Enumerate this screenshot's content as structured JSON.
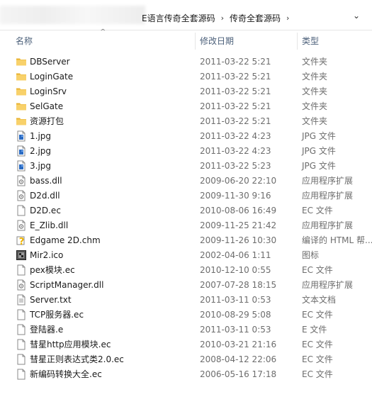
{
  "breadcrumb": {
    "parent": "E语言传奇全套源码",
    "current": "传奇全套源码"
  },
  "columns": {
    "name": "名称",
    "date": "修改日期",
    "type": "类型"
  },
  "files": [
    {
      "name": "DBServer",
      "date": "2011-03-22 5:21",
      "type": "文件夹",
      "icon": "folder-icon"
    },
    {
      "name": "LoginGate",
      "date": "2011-03-22 5:21",
      "type": "文件夹",
      "icon": "folder-icon"
    },
    {
      "name": "LoginSrv",
      "date": "2011-03-22 5:21",
      "type": "文件夹",
      "icon": "folder-icon"
    },
    {
      "name": "SelGate",
      "date": "2011-03-22 5:21",
      "type": "文件夹",
      "icon": "folder-icon"
    },
    {
      "name": "资源打包",
      "date": "2011-03-22 5:21",
      "type": "文件夹",
      "icon": "folder-icon"
    },
    {
      "name": "1.jpg",
      "date": "2011-03-22 4:23",
      "type": "JPG 文件",
      "icon": "image-file-icon"
    },
    {
      "name": "2.jpg",
      "date": "2011-03-22 4:23",
      "type": "JPG 文件",
      "icon": "image-file-icon"
    },
    {
      "name": "3.jpg",
      "date": "2011-03-22 5:23",
      "type": "JPG 文件",
      "icon": "image-file-icon"
    },
    {
      "name": "bass.dll",
      "date": "2009-06-20 22:10",
      "type": "应用程序扩展",
      "icon": "dll-file-icon"
    },
    {
      "name": "D2d.dll",
      "date": "2009-11-30 9:16",
      "type": "应用程序扩展",
      "icon": "dll-file-icon"
    },
    {
      "name": "D2D.ec",
      "date": "2010-08-06 16:49",
      "type": "EC 文件",
      "icon": "blank-file-icon"
    },
    {
      "name": "E_Zlib.dll",
      "date": "2009-11-25 21:42",
      "type": "应用程序扩展",
      "icon": "dll-file-icon"
    },
    {
      "name": "Edgame 2D.chm",
      "date": "2009-11-26 10:30",
      "type": "编译的 HTML 帮...",
      "icon": "help-file-icon"
    },
    {
      "name": "Mir2.ico",
      "date": "2002-04-06 1:11",
      "type": "图标",
      "icon": "ico-file-icon"
    },
    {
      "name": "pex模块.ec",
      "date": "2010-12-10 0:55",
      "type": "EC 文件",
      "icon": "blank-file-icon"
    },
    {
      "name": "ScriptManager.dll",
      "date": "2007-07-28 18:15",
      "type": "应用程序扩展",
      "icon": "dll-file-icon"
    },
    {
      "name": "Server.txt",
      "date": "2011-03-11 0:53",
      "type": "文本文档",
      "icon": "text-file-icon"
    },
    {
      "name": "TCP服务器.ec",
      "date": "2010-08-29 5:08",
      "type": "EC 文件",
      "icon": "blank-file-icon"
    },
    {
      "name": "登陆器.e",
      "date": "2011-03-11 0:53",
      "type": "E 文件",
      "icon": "blank-file-icon"
    },
    {
      "name": "彗星http应用模块.ec",
      "date": "2010-03-21 21:16",
      "type": "EC 文件",
      "icon": "blank-file-icon"
    },
    {
      "name": "彗星正则表达式类2.0.ec",
      "date": "2008-04-12 22:06",
      "type": "EC 文件",
      "icon": "blank-file-icon"
    },
    {
      "name": "新编码转换大全.ec",
      "date": "2006-05-16 17:18",
      "type": "EC 文件",
      "icon": "blank-file-icon"
    }
  ],
  "colors": {
    "folder": "#f5c343",
    "header_text": "#4c607a",
    "secondary_text": "#6d6d6d",
    "image_blue": "#2b6cc4"
  }
}
